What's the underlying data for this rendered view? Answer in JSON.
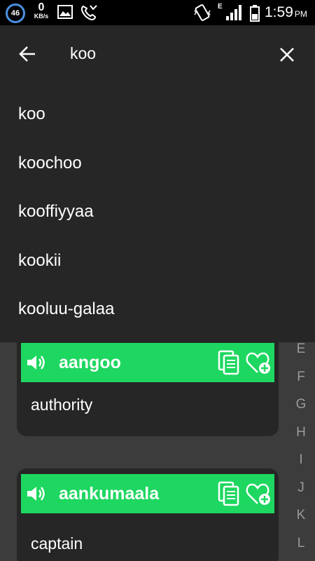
{
  "status_bar": {
    "notification_count": "46",
    "data_speed": "0",
    "data_unit": "KB/s",
    "network_type": "E",
    "time": "1:59",
    "ampm": "PM",
    "icons": [
      "notification-count-icon",
      "image-icon",
      "missed-call-icon",
      "vibrate-icon",
      "signal-icon",
      "battery-icon"
    ]
  },
  "search": {
    "query": "koo",
    "suggestions": [
      "koo",
      "koochoo",
      "kooffiyyaa",
      "kookii",
      "kooluu-galaa"
    ]
  },
  "entries": [
    {
      "word": "aangoo",
      "meaning": "authority"
    },
    {
      "word": "aankumaala",
      "meaning": "captain"
    }
  ],
  "alphabet_index": [
    "E",
    "F",
    "G",
    "H",
    "I",
    "J",
    "K",
    "L"
  ],
  "colors": {
    "accent": "#1ed760",
    "panel": "#262626",
    "background": "#3c3c3c",
    "status_bar": "#000000",
    "index_text": "#9a9a9a"
  }
}
